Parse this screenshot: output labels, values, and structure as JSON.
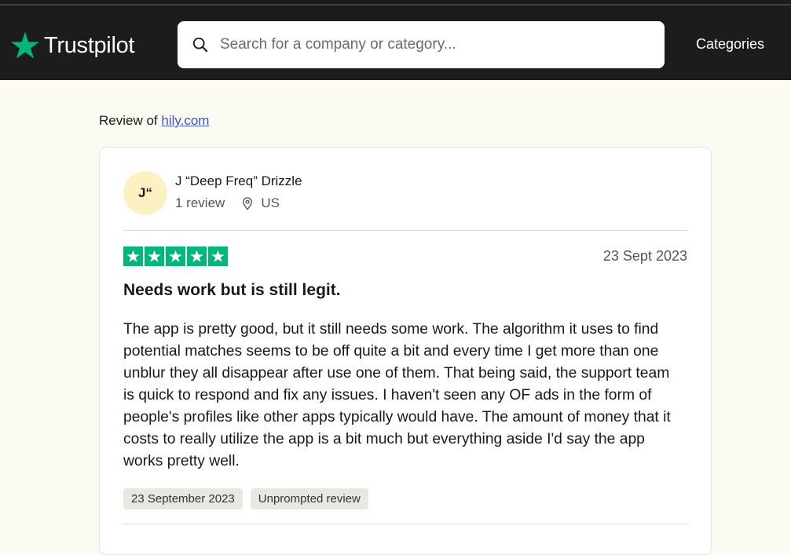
{
  "header": {
    "logo_text": "Trustpilot",
    "search": {
      "placeholder": "Search for a company or category..."
    },
    "categories_label": "Categories"
  },
  "page": {
    "review_of_prefix": "Review of",
    "company_link": "hily.com"
  },
  "review": {
    "avatar_initials": "J“",
    "author_name": "J “Deep Freq” Drizzle",
    "review_count": "1 review",
    "country": "US",
    "rating": 5,
    "max_rating": 5,
    "date": "23 Sept 2023",
    "title": "Needs work but is still legit.",
    "body": "The app is pretty good, but it still needs some work. The algorithm it uses to find potential matches seems to be off quite a bit and every time I get more than one unblur they all disappear after use one of them. That being said, the support team is quick to respond and fix any issues. I haven't seen any OF ads in the form of people's profiles like other apps typically would have. The amount of money that it costs to really utilize the app is a bit much but everything aside I'd say the app works pretty well.",
    "tags": [
      "23 September 2023",
      "Unprompted review"
    ]
  },
  "colors": {
    "brand_green": "#00b67a",
    "header_bg": "#1c1c1c",
    "page_bg": "#fcfbf3",
    "link": "#3c57bc",
    "avatar_bg": "#fcf1c2"
  },
  "icons": [
    "trustpilot-star-icon",
    "search-icon",
    "location-pin-icon",
    "star-icon"
  ]
}
